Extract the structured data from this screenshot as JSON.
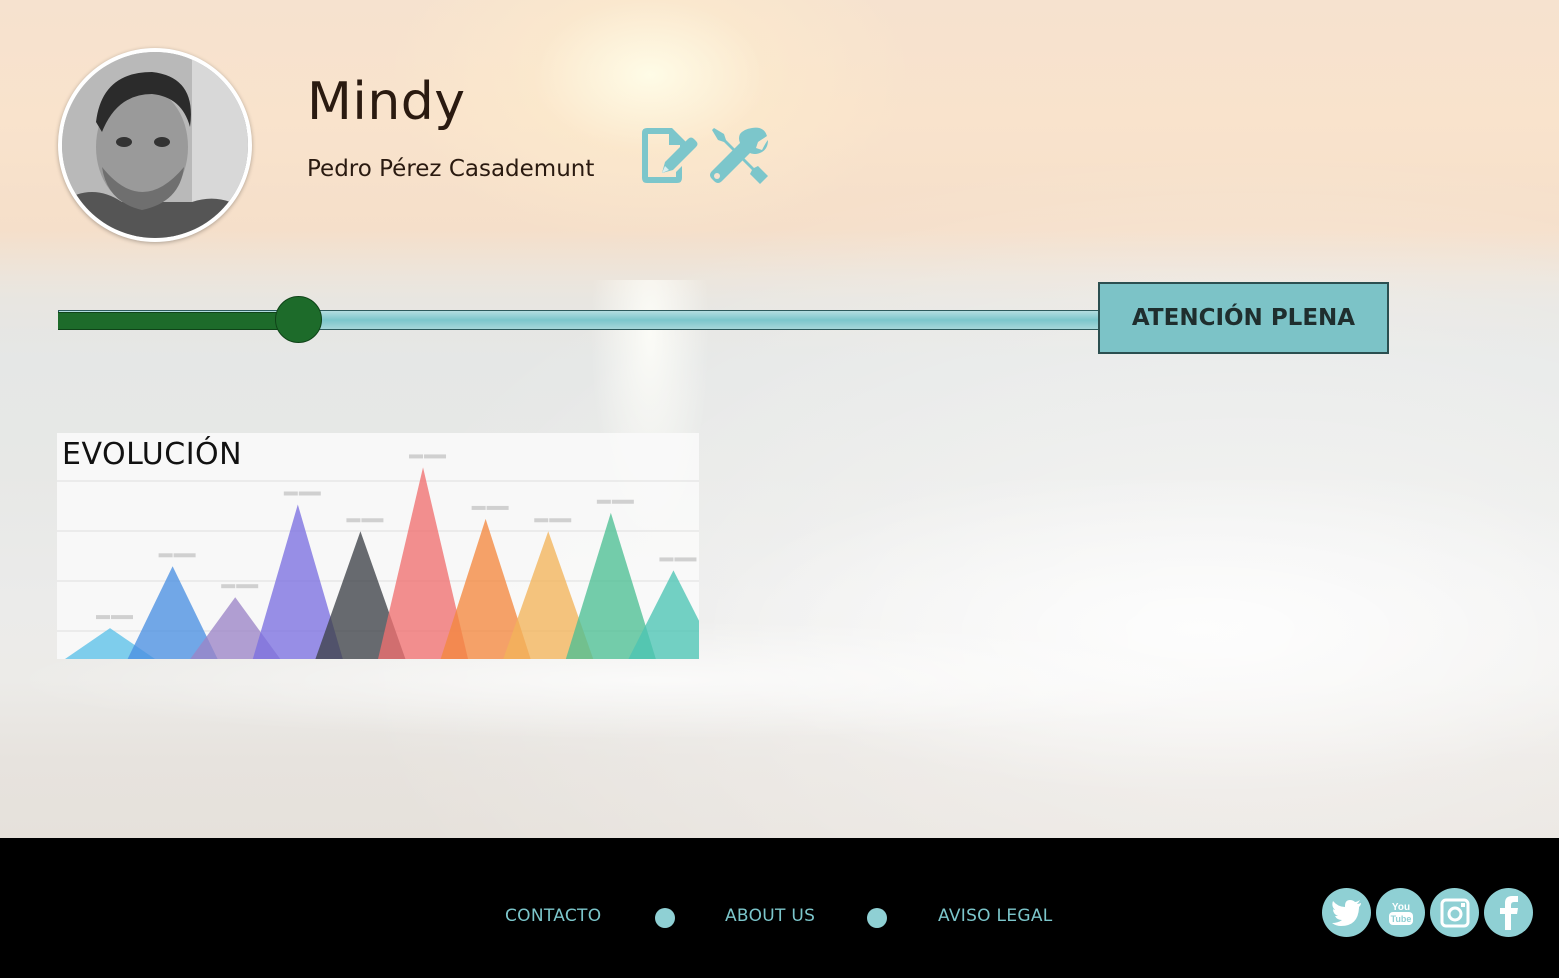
{
  "profile": {
    "name": "Mindy",
    "full_name": "Pedro Pérez Casademunt"
  },
  "progress": {
    "value_fraction": 0.23,
    "level_label": "ATENCIÓN PLENA"
  },
  "colors": {
    "accent": "#7cc6cb",
    "progress_fill": "#1d6b2a",
    "footer_bg": "#000000"
  },
  "chart": {
    "title": "EVOLUCIÓN"
  },
  "chart_data": {
    "type": "area",
    "title": "EVOLUCIÓN",
    "xlabel": "",
    "ylabel": "",
    "grid": true,
    "ylim": [
      0,
      100
    ],
    "series": [
      {
        "values": [
          15
        ],
        "color": "#5bc0e8"
      },
      {
        "values": [
          45
        ],
        "color": "#4a90e2"
      },
      {
        "values": [
          30
        ],
        "color": "#9b84c6"
      },
      {
        "values": [
          75
        ],
        "color": "#7b6fe0"
      },
      {
        "values": [
          62
        ],
        "color": "#3d4148"
      },
      {
        "values": [
          93
        ],
        "color": "#f07070"
      },
      {
        "values": [
          68
        ],
        "color": "#f3883f"
      },
      {
        "values": [
          62
        ],
        "color": "#f2b45a"
      },
      {
        "values": [
          71
        ],
        "color": "#4dbf93"
      },
      {
        "values": [
          43
        ],
        "color": "#4cc4b4"
      }
    ]
  },
  "footer": {
    "links": [
      "CONTACTO",
      "ABOUT US",
      "AVISO LEGAL"
    ],
    "social": [
      "twitter-icon",
      "youtube-icon",
      "instagram-icon",
      "facebook-icon"
    ]
  }
}
